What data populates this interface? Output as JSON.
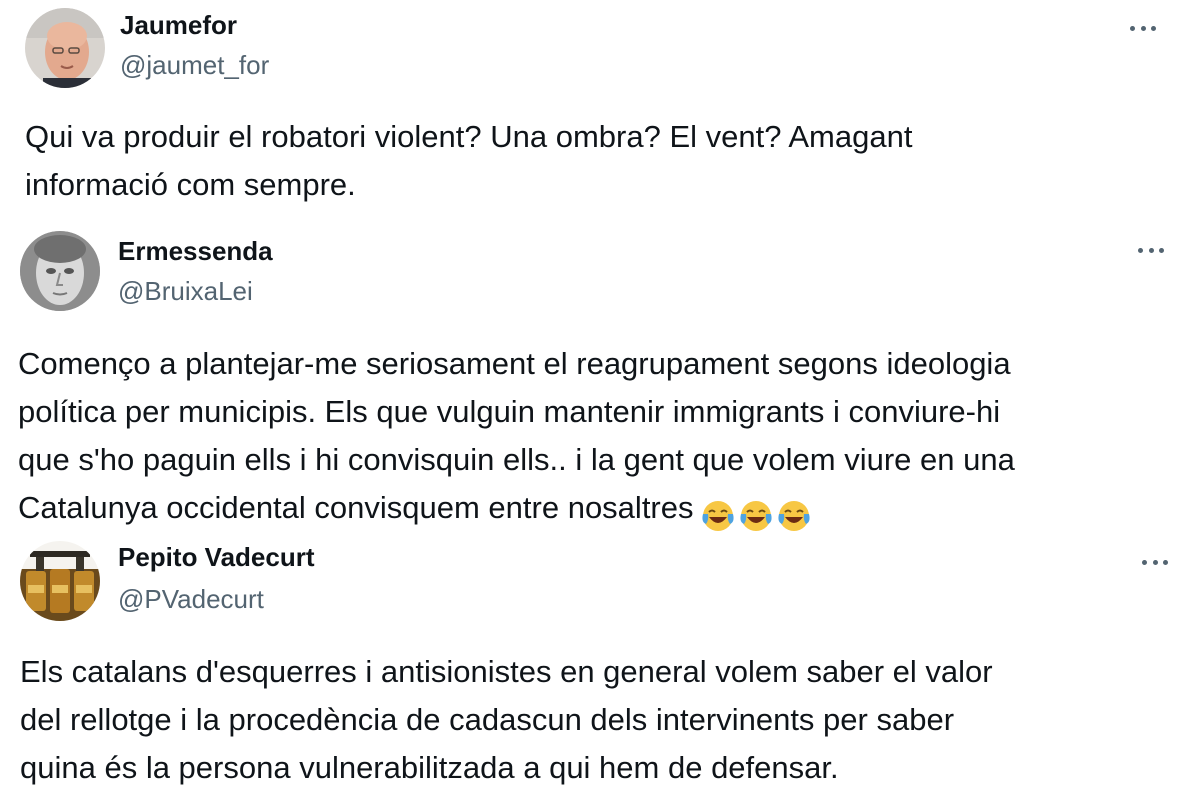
{
  "tweets": [
    {
      "display_name": "Jaumefor",
      "handle": "@jaumet_for",
      "avatar_icon": "avatar-bald-man",
      "lines": [
        "Qui va produir el robatori violent? Una ombra? El vent? Amagant",
        "informació com sempre."
      ]
    },
    {
      "display_name": "Ermessenda",
      "handle": "@BruixaLei",
      "avatar_icon": "avatar-statue-face",
      "lines": [
        "Començo a plantejar-me seriosament el reagrupament segons ideologia",
        "política per municipis. Els que vulguin mantenir immigrants i conviure-hi",
        "que s'ho paguin ells i hi convisquin ells.. i la gent que volem viure en una",
        "Catalunya occidental convisquem entre nosaltres"
      ],
      "emojis": [
        "face-with-tears-of-joy",
        "face-with-tears-of-joy",
        "face-with-tears-of-joy"
      ]
    },
    {
      "display_name": "Pepito Vadecurt",
      "handle": "@PVadecurt",
      "avatar_icon": "avatar-jars",
      "lines": [
        "Els catalans d'esquerres i antisionistes en general volem saber el valor",
        "del rellotge i la procedència de cadascun dels intervinents per saber",
        "quina és la persona vulnerabilitzada a qui hem de defensar."
      ]
    }
  ],
  "colors": {
    "text": "#0f1419",
    "secondary": "#536471",
    "emoji_face": "#f7c744",
    "emoji_tear": "#4fa3e0"
  }
}
